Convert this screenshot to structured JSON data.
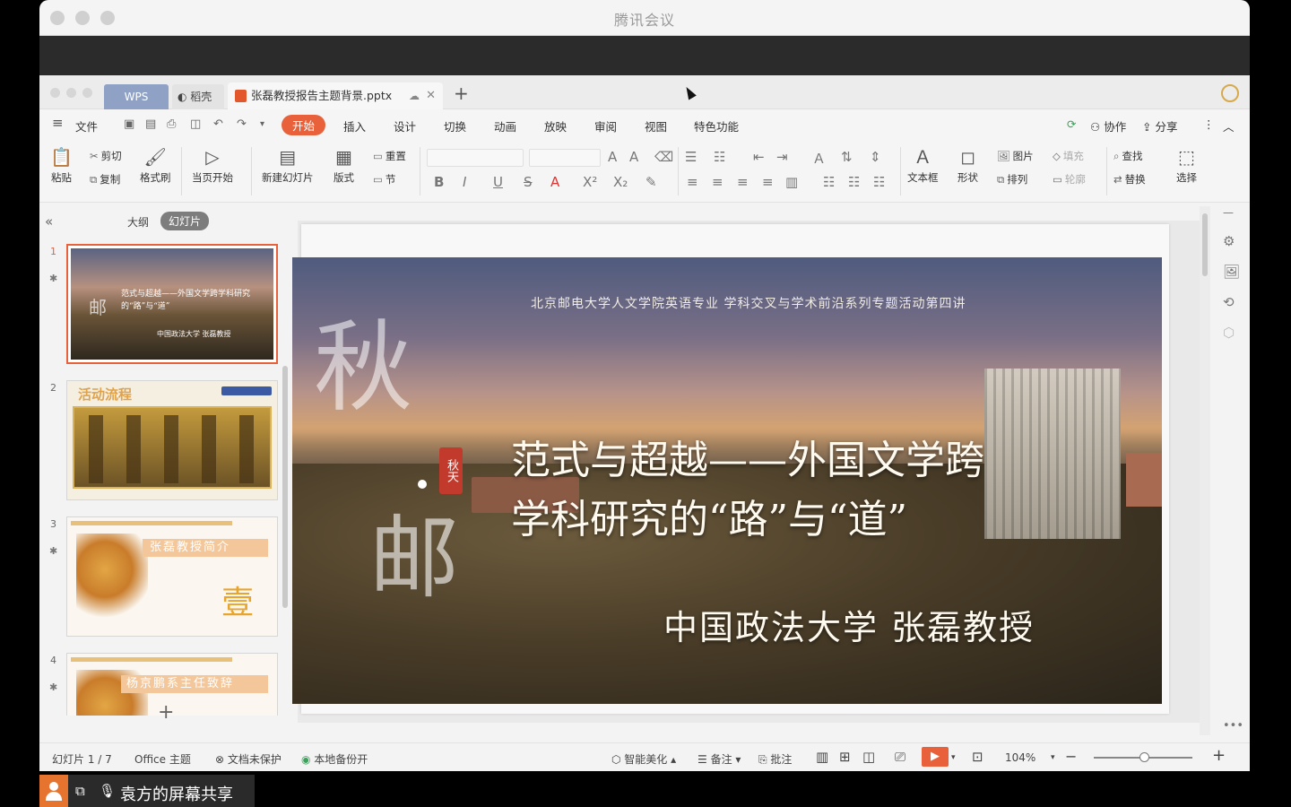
{
  "meeting": {
    "title": "腾讯会议"
  },
  "wps": {
    "tabs": {
      "wps": "WPS",
      "daoke": "稻壳",
      "file": "张磊教授报告主题背景.pptx"
    },
    "menu": {
      "file": "文件",
      "items": [
        "开始",
        "插入",
        "设计",
        "切换",
        "动画",
        "放映",
        "审阅",
        "视图",
        "特色功能"
      ],
      "right": {
        "collab": "协作",
        "share": "分享"
      }
    },
    "ribbon": {
      "paste": "粘贴",
      "cut": "剪切",
      "copy": "复制",
      "format_painter": "格式刷",
      "play_current": "当页开始",
      "new_slide": "新建幻灯片",
      "layout": "版式",
      "reset": "重置",
      "section": "节",
      "textbox": "文本框",
      "shape": "形状",
      "picture": "图片",
      "arrange": "排列",
      "fill": "填充",
      "outline": "轮廓",
      "find": "查找",
      "replace": "替换",
      "select": "选择"
    },
    "left_panel": {
      "tab_outline": "大纲",
      "tab_slides": "幻灯片",
      "thumbs": [
        {
          "num": "1",
          "title": "范式与超越——外国文学跨学科研究的“路”与“道”",
          "sub": "中国政法大学  张磊教授",
          "big": "邮"
        },
        {
          "num": "2",
          "title": "活动流程"
        },
        {
          "num": "3",
          "title": "张磊教授简介",
          "big": "壹"
        },
        {
          "num": "4",
          "title": "杨京鹏系主任致辞"
        }
      ]
    },
    "slide": {
      "header": "北京邮电大学人文学院英语专业  学科交叉与学术前沿系列专题活动第四讲",
      "title_line1": "范式与超越——外国文学跨",
      "title_line2": "学科研究的“路”与“道”",
      "speaker": "中国政法大学  张磊教授",
      "big_char1": "秋",
      "big_char2": "邮",
      "seal": "秋天"
    },
    "status": {
      "slide_count": "幻灯片 1 / 7",
      "theme": "Office 主题",
      "protect": "文档未保护",
      "backup": "本地备份开",
      "beautify": "智能美化",
      "notes": "备注",
      "comment": "批注",
      "zoom": "104%"
    },
    "colors": {
      "accent": "#e8613a"
    }
  },
  "share": {
    "text": "袁方的屏幕共享"
  }
}
